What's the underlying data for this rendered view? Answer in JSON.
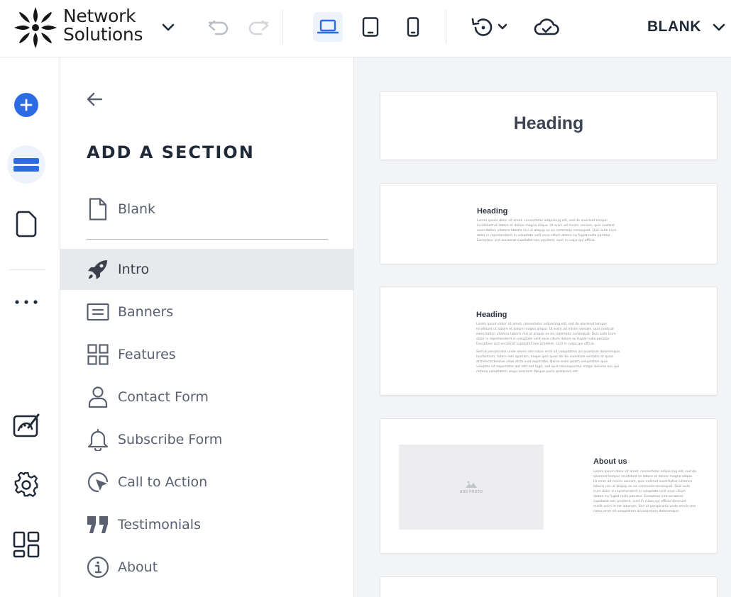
{
  "brand": {
    "line1": "Network",
    "line2": "Solutions",
    "icon": "network-solutions-logo"
  },
  "toolbar": {
    "undo_icon": "undo-icon",
    "redo_icon": "redo-icon",
    "devices": [
      "desktop-icon",
      "tablet-icon",
      "mobile-icon"
    ],
    "history_icon": "history-icon",
    "cloud_icon": "cloud-save-icon",
    "page_selector": "BLANK"
  },
  "rail": {
    "items": [
      "add-icon",
      "sections-icon",
      "pages-icon",
      "more-icon",
      "design-icon",
      "settings-icon",
      "apps-icon"
    ],
    "active": "sections-icon"
  },
  "panel": {
    "title": "ADD A SECTION",
    "items": [
      {
        "label": "Blank",
        "icon": "blank-page-icon"
      },
      {
        "label": "Intro",
        "icon": "rocket-icon",
        "active": true
      },
      {
        "label": "Banners",
        "icon": "banner-icon"
      },
      {
        "label": "Features",
        "icon": "grid-icon"
      },
      {
        "label": "Contact Form",
        "icon": "person-icon"
      },
      {
        "label": "Subscribe Form",
        "icon": "bell-icon"
      },
      {
        "label": "Call to Action",
        "icon": "cursor-click-icon"
      },
      {
        "label": "Testimonials",
        "icon": "quote-icon"
      },
      {
        "label": "About",
        "icon": "info-icon"
      }
    ]
  },
  "preview": {
    "cards": [
      {
        "heading": "Heading"
      },
      {
        "heading": "Heading",
        "body": "Lorem ipsum dolor sit amet, consectetur adipiscing elit, sed do eiusmod tempor incididunt ut labore et dolore magna aliqua. Ut enim ad minim veniam, quis nostrud exercitation ullamco laboris nisi ut aliquip ex ea commodo consequat. Duis aute irure dolor in reprehenderit in voluptate velit esse cillum dolore eu fugiat nulla pariatur. Excepteur sint occaecat cupidatat non proident, sunt in culpa qui officia."
      },
      {
        "heading": "Heading",
        "body": "Lorem ipsum dolor sit amet, consectetur adipiscing elit, sed do eiusmod tempor incididunt ut labore et dolore magna aliqua. Ut enim ad minim veniam, quis nostrud exercitation ullamco laboris nisi ut aliquip ex ea commodo consequat. Duis aute irure dolor in reprehenderit in voluptate velit esse cillum dolore eu fugiat nulla pariatur. Excepteur sint occaecat cupidatat non proident, sunt in culpa qui officia.",
        "body2": "Sed ut perspiciatis unde omnis iste natus error sit voluptatem accusantium doloremque laudantium, totam rem aperiam, eaque ipsa quae ab illo inventore veritatis et quasi architecto beatae vitae dicta sunt explicabo. Nemo enim ipsam voluptatem quia voluptas sit aspernatur aut odit aut fugit, sed quia consequuntur magni dolores eos qui ratione voluptatem sequi nesciunt. Neque porro quisquam est."
      },
      {
        "heading": "About us",
        "photo_label": "ADD PHOTO",
        "body": "Lorem ipsum dolor sit amet, consectetur adipiscing elit, sed do eiusmod tempor incididunt ut labore et dolore magna aliqua. Ut enim ad minim veniam, quis nostrud exercitation ullamco laboris nisi ut aliquip ex ea commodo consequat. Duis aute irure dolor in reprehenderit in voluptate velit esse cillum dolore eu fugiat nulla pariatur. Excepteur sint occaecat cupidatat non proident, sunt in culpa qui officia deserunt mollit anim id est laborum. Sed ut perspiciatis unde omnis iste natus error sit voluptatem accusantium doloremque."
      }
    ]
  },
  "colors": {
    "accent": "#2d6be4",
    "text": "#1f2937",
    "muted": "#5a6070",
    "active_bg": "#e8e9ec"
  }
}
